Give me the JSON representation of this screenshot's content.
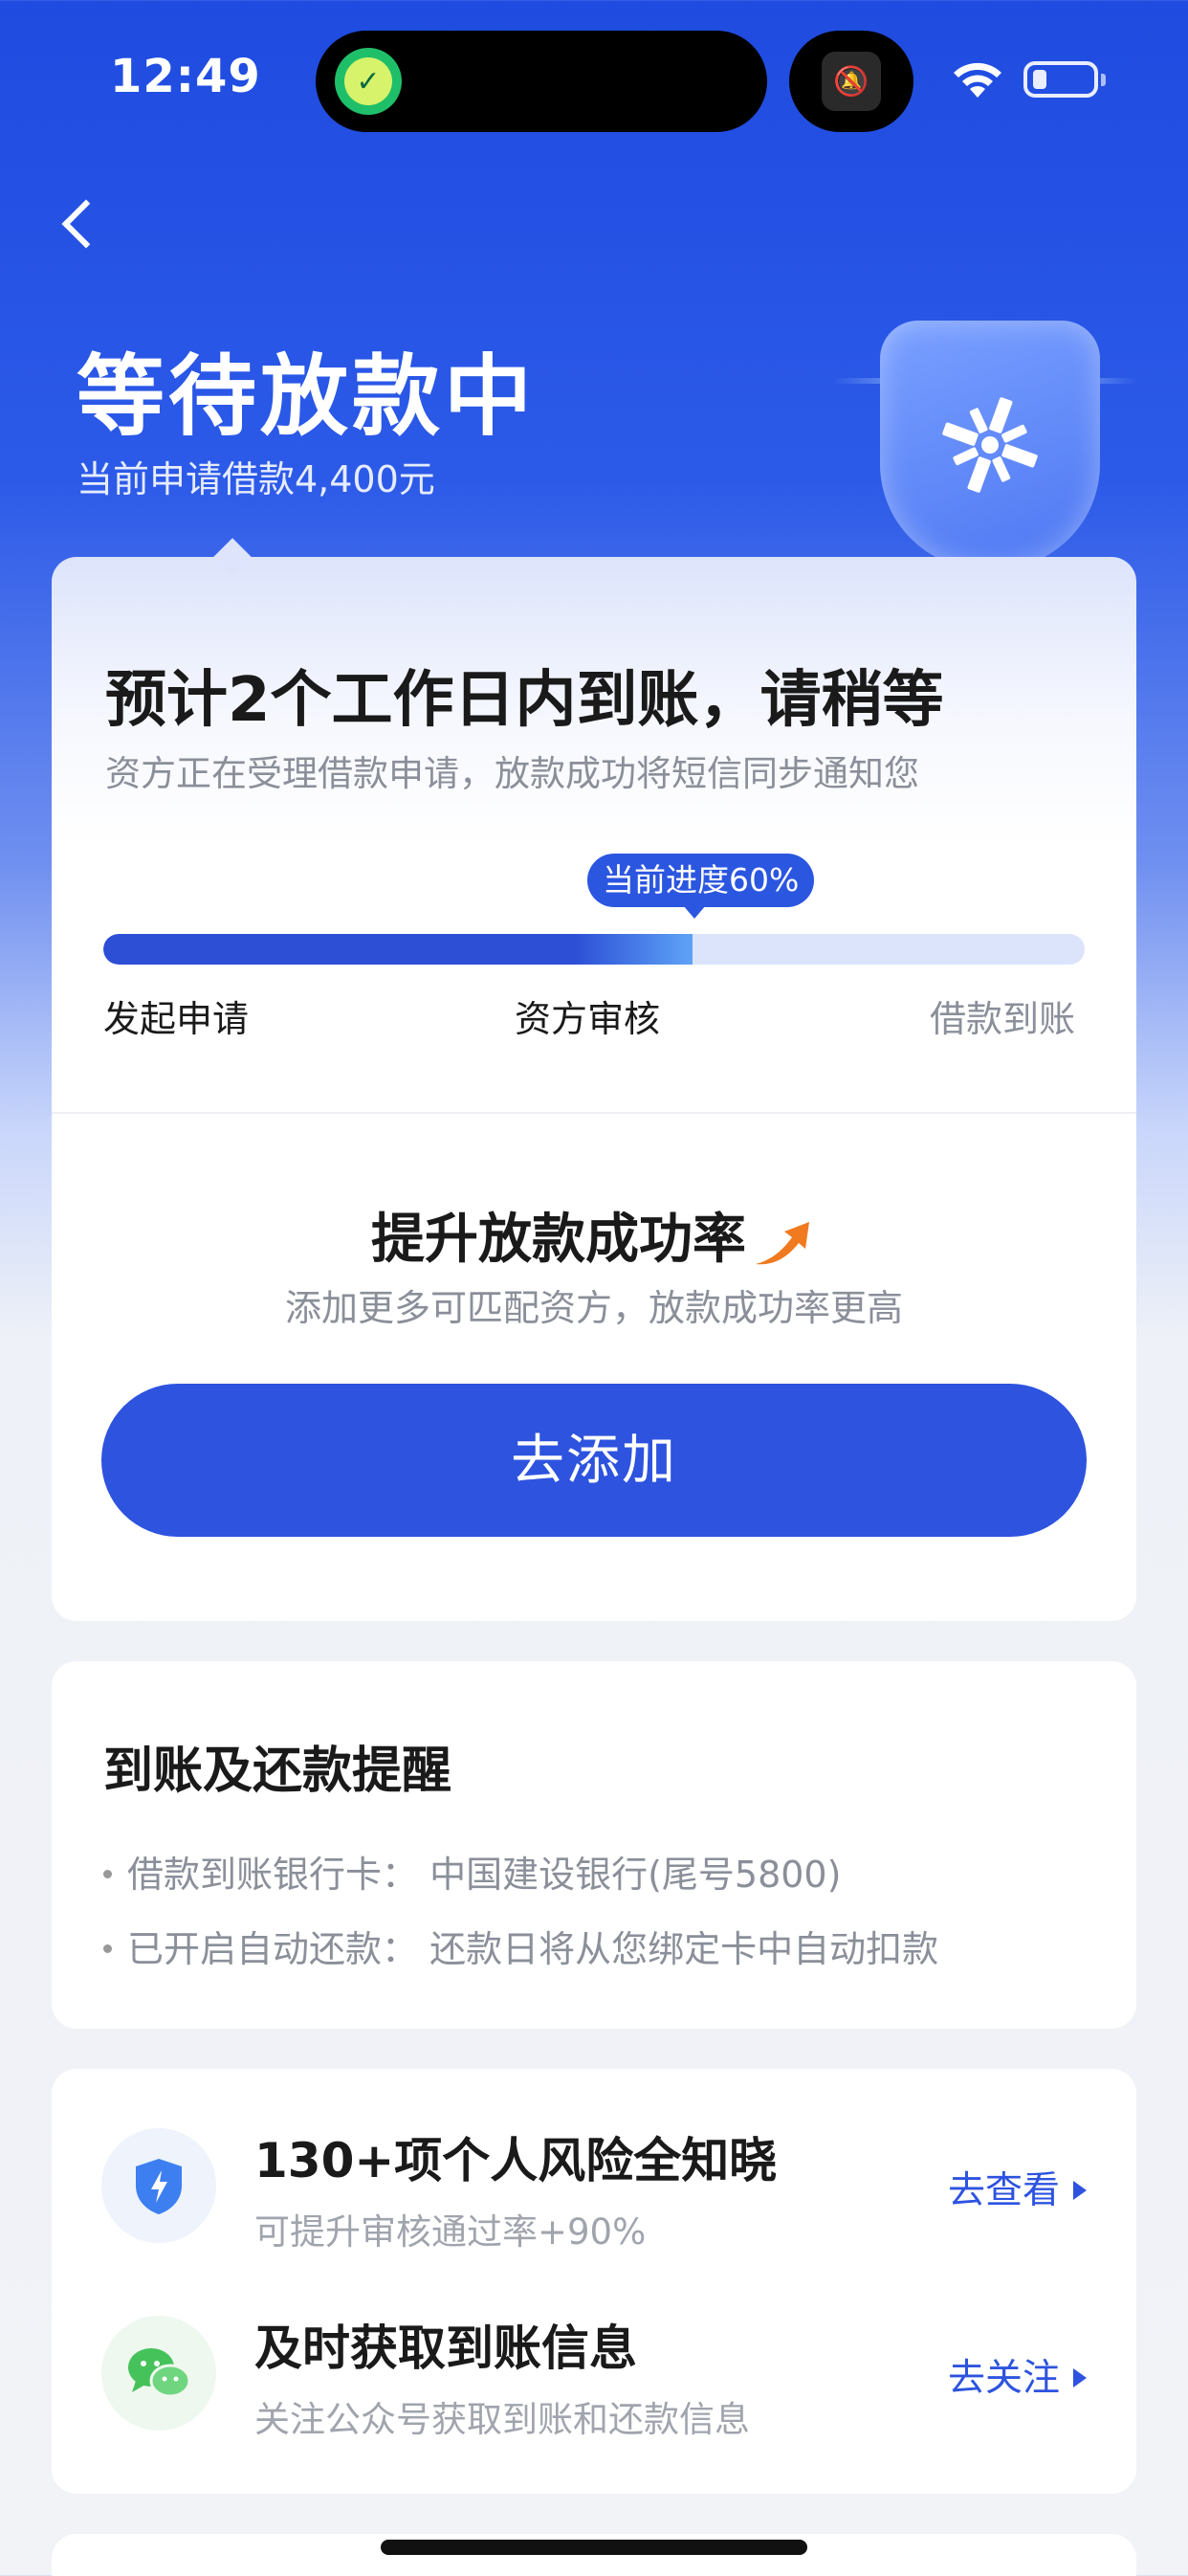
{
  "status_bar": {
    "time": "12:49"
  },
  "header": {
    "title": "等待放款中",
    "subtitle": "当前申请借款4,400元"
  },
  "progress_card": {
    "eta_title": "预计2个工作日内到账，请稍等",
    "eta_subtitle": "资方正在受理借款申请，放款成功将短信同步通知您",
    "progress_label": "当前进度60%",
    "progress_value": 0.6,
    "steps": [
      "发起申请",
      "资方审核",
      "借款到账"
    ],
    "boost_title": "提升放款成功率",
    "boost_subtitle": "添加更多可匹配资方，放款成功率更高",
    "add_button": "去添加"
  },
  "reminder_card": {
    "title": "到账及还款提醒",
    "items": [
      "借款到账银行卡：  中国建设银行(尾号5800)",
      "已开启自动还款：  还款日将从您绑定卡中自动扣款"
    ]
  },
  "features": [
    {
      "icon": "shield-bolt-icon",
      "title": "130+项个人风险全知晓",
      "subtitle": "可提升审核通过率+90%",
      "link": "去查看"
    },
    {
      "icon": "wechat-icon",
      "title": "及时获取到账信息",
      "subtitle": "关注公众号获取到账和还款信息",
      "link": "去关注"
    }
  ],
  "colors": {
    "primary": "#2d53df",
    "header_bg": "#1f4be0",
    "muted_text": "#8a8f99"
  }
}
